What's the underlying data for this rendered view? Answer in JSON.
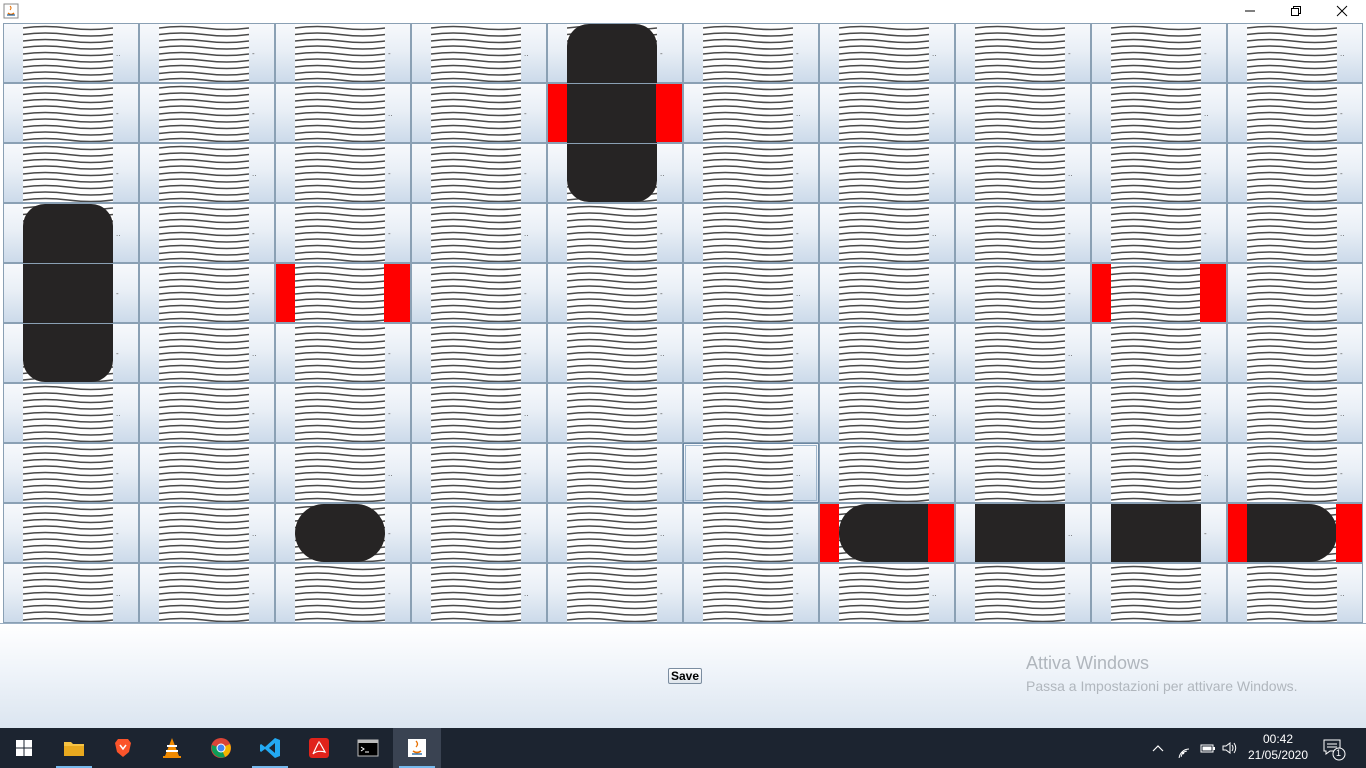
{
  "window": {
    "controls": {
      "minimize": "minimize-icon",
      "maximize": "restore-icon",
      "close": "close-icon"
    },
    "app_icon": "java-icon"
  },
  "board": {
    "rows": 10,
    "cols": 10,
    "cell_tick": "..",
    "cell_mark": "-",
    "tile_icon": "water-wave-tile",
    "colors": {
      "ship": "#262424",
      "hit": "#ff0000",
      "cell_top": "#f7f9fc",
      "cell_bottom": "#ccdaea"
    },
    "selected_cell": {
      "row": 7,
      "col": 5
    },
    "ships": [
      {
        "orientation": "vertical",
        "col": 4,
        "row_start": 0,
        "length": 3
      },
      {
        "orientation": "vertical",
        "col": 0,
        "row_start": 3,
        "length": 3
      },
      {
        "orientation": "horizontal",
        "row": 8,
        "col_start": 2,
        "length": 1
      },
      {
        "orientation": "horizontal",
        "row": 8,
        "col_start": 6,
        "length": 4
      }
    ],
    "hits": [
      {
        "row": 1,
        "col": 4,
        "side": "both"
      },
      {
        "row": 4,
        "col": 2,
        "side": "both"
      },
      {
        "row": 4,
        "col": 8,
        "side": "both"
      },
      {
        "row": 8,
        "col": 6,
        "side": "both"
      },
      {
        "row": 8,
        "col": 9,
        "side": "both"
      }
    ]
  },
  "panel": {
    "save_label": "Save",
    "watermark_title": "Attiva Windows",
    "watermark_subtitle": "Passa a Impostazioni per attivare Windows."
  },
  "taskbar": {
    "start_icon": "windows-start-icon",
    "apps": [
      {
        "name": "file-explorer-icon",
        "color": "#f6c343"
      },
      {
        "name": "brave-browser-icon",
        "color": "#fb542b"
      },
      {
        "name": "vlc-icon",
        "color": "#f08a00"
      },
      {
        "name": "chrome-icon",
        "color": "#4285f4"
      },
      {
        "name": "vscode-icon",
        "color": "#23a9f2"
      },
      {
        "name": "acrobat-reader-icon",
        "color": "#e0231b"
      },
      {
        "name": "terminal-icon",
        "color": "#000000"
      },
      {
        "name": "java-icon",
        "color": "#e76f00"
      }
    ],
    "time": "00:42",
    "date": "21/05/2020",
    "notification_count": "1",
    "tray_icons": [
      "chevron-up-icon",
      "wifi-icon",
      "battery-icon",
      "volume-icon"
    ]
  }
}
